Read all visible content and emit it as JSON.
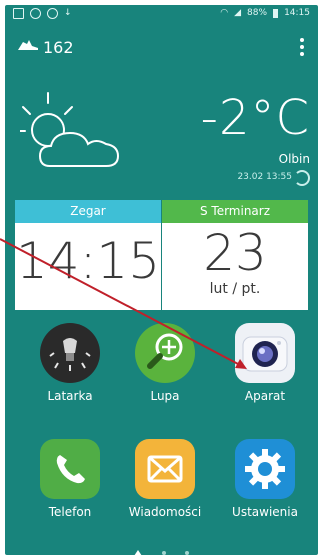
{
  "status_bar": {
    "battery": "88%",
    "time": "14:15"
  },
  "top": {
    "step_count": "162"
  },
  "weather": {
    "temperature": "-2°C",
    "city": "Olbin",
    "updated": "23.02 13:55"
  },
  "clock_widget": {
    "title": "Zegar",
    "time": "14:15"
  },
  "calendar_widget": {
    "title": "S Terminarz",
    "day": "23",
    "subtitle": "lut / pt."
  },
  "apps_row1": [
    {
      "label": "Latarka",
      "icon": "flashlight-icon"
    },
    {
      "label": "Lupa",
      "icon": "magnifier-icon"
    },
    {
      "label": "Aparat",
      "icon": "camera-icon"
    }
  ],
  "apps_row2": [
    {
      "label": "Telefon",
      "icon": "phone-icon"
    },
    {
      "label": "Wiadomości",
      "icon": "message-icon"
    },
    {
      "label": "Ustawienia",
      "icon": "settings-icon"
    }
  ],
  "colors": {
    "background": "#18847c",
    "clock_header": "#3ebfd6",
    "calendar_header": "#52b84b",
    "annotation_arrow": "#c0202a"
  }
}
